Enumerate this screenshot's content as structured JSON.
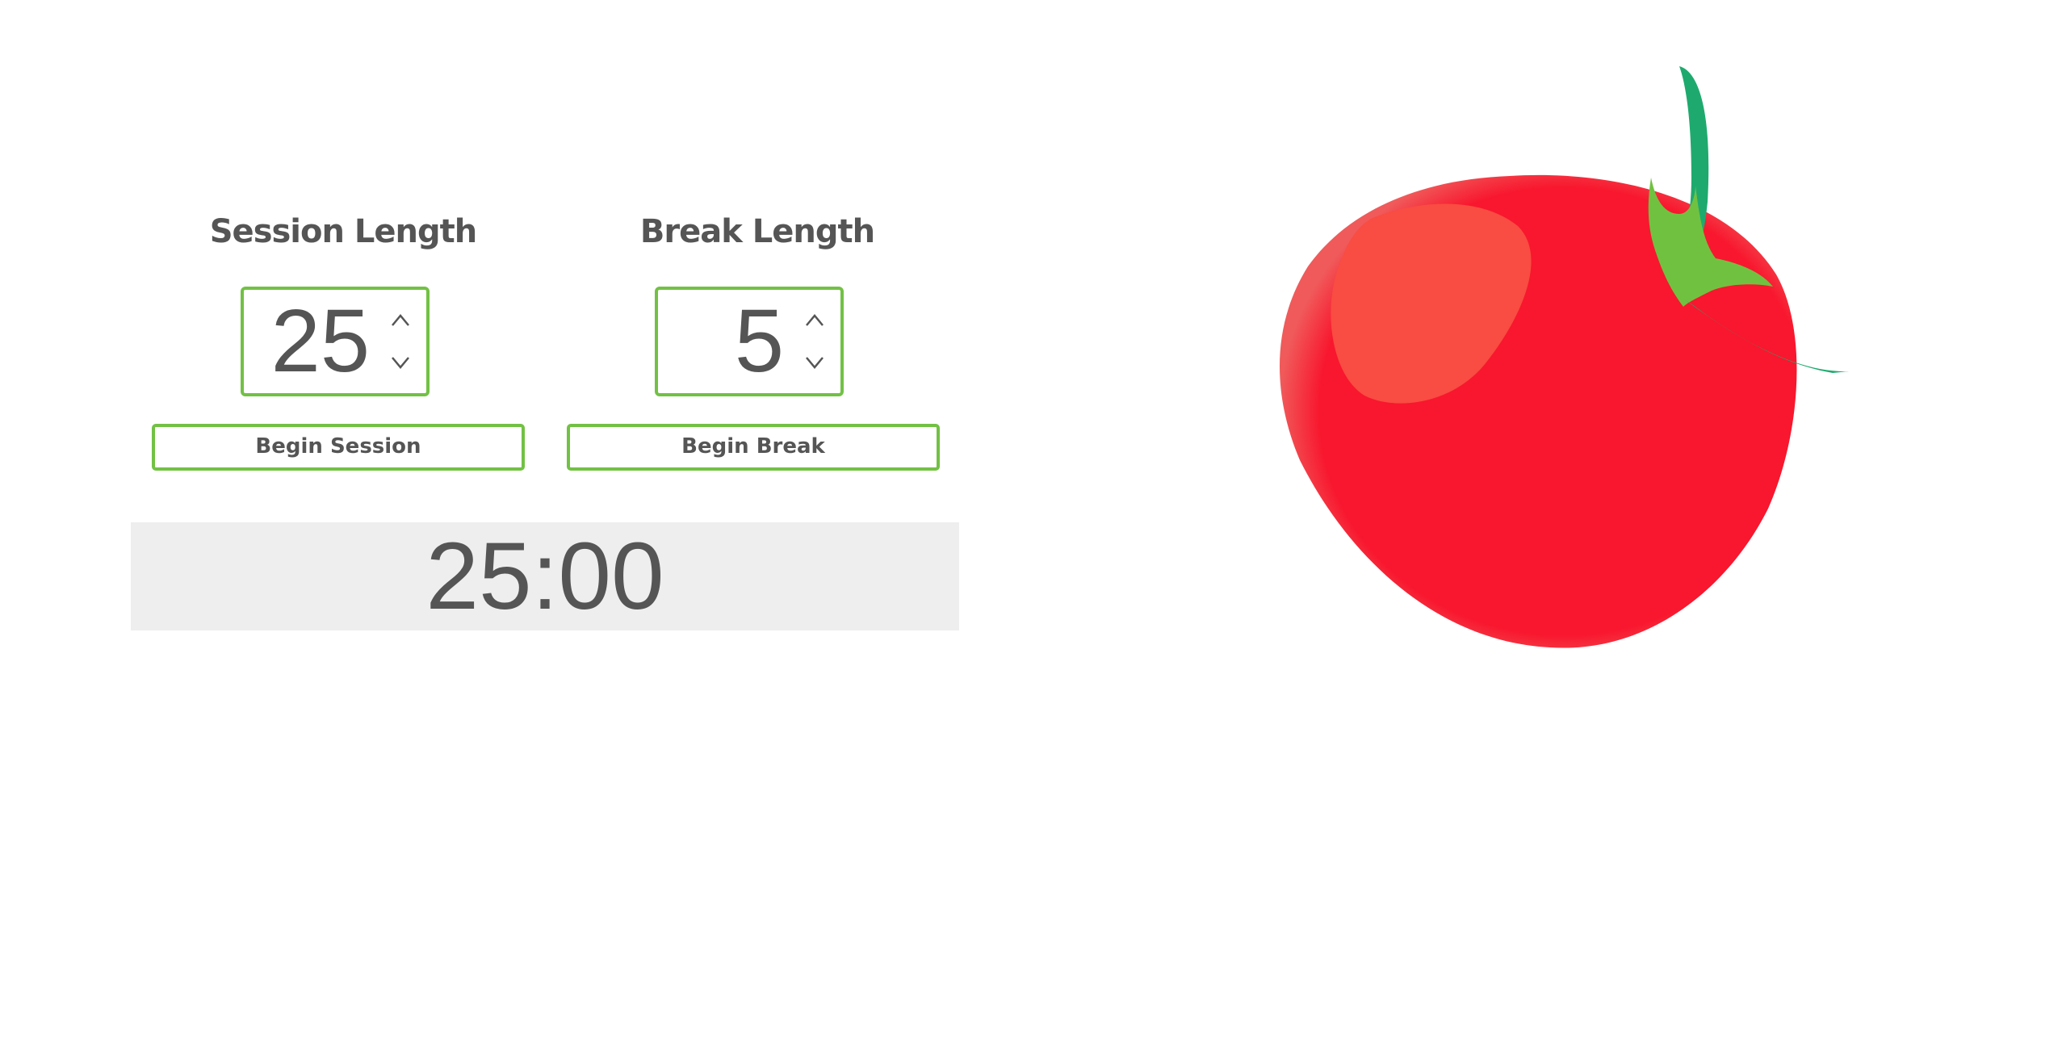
{
  "session": {
    "heading": "Session Length",
    "value": "25",
    "up_icon": "chevron-up-icon",
    "down_icon": "chevron-down-icon",
    "begin_label": "Begin Session"
  },
  "break": {
    "heading": "Break Length",
    "value": "5",
    "up_icon": "chevron-up-icon",
    "down_icon": "chevron-down-icon",
    "begin_label": "Begin Break"
  },
  "timer": {
    "display": "25:00"
  },
  "illustration": {
    "icon": "tomato-icon"
  },
  "colors": {
    "accent_green": "#72c144",
    "text_gray": "#555555",
    "timer_background": "#eeeeee",
    "tomato_red": "#f8172e",
    "stem_dark_green": "#1eaa6e"
  }
}
